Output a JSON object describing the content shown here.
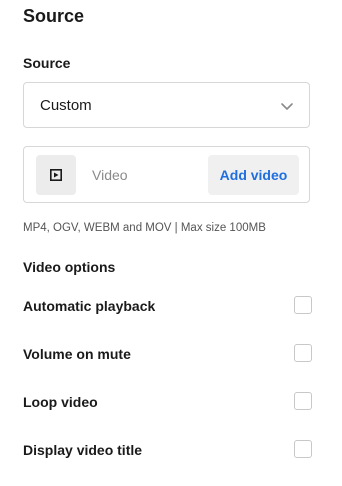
{
  "section": {
    "title": "Source"
  },
  "source_field": {
    "label": "Source",
    "selected": "Custom"
  },
  "video_field": {
    "placeholder": "Video",
    "add_label": "Add video",
    "helper": "MP4, OGV, WEBM and MOV | Max size 100MB"
  },
  "options": {
    "title": "Video options",
    "items": [
      {
        "label": "Automatic playback",
        "checked": false
      },
      {
        "label": "Volume on mute",
        "checked": false
      },
      {
        "label": "Loop video",
        "checked": false
      },
      {
        "label": "Display video title",
        "checked": false
      }
    ]
  },
  "colors": {
    "accent": "#1f6fe0",
    "border": "#d7d7d7",
    "thumb_bg": "#ececec"
  },
  "icons": {
    "select_chevron": "chevron-down-icon",
    "video_thumb": "video-frame-icon"
  }
}
